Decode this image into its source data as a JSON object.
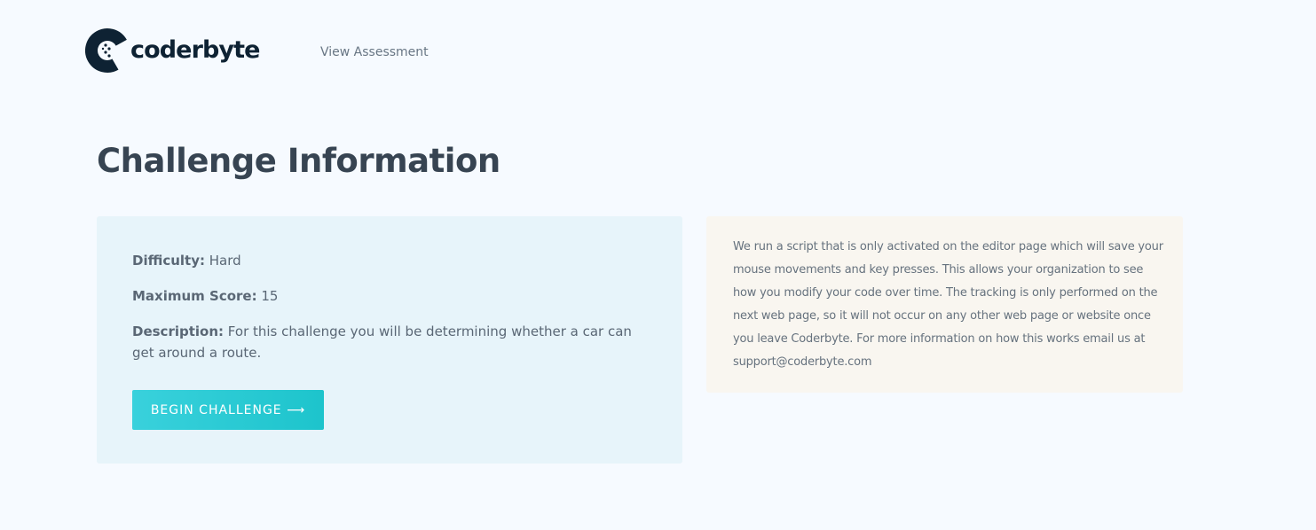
{
  "header": {
    "logo_text": "coderbyte",
    "nav_link": "View Assessment"
  },
  "page": {
    "title": "Challenge Information"
  },
  "challenge": {
    "difficulty_label": "Difficulty:",
    "difficulty_value": "Hard",
    "max_score_label": "Maximum Score:",
    "max_score_value": "15",
    "description_label": "Description:",
    "description_value": "For this challenge you will be determining whether a car can get around a route.",
    "begin_button": "BEGIN CHALLENGE ⟶"
  },
  "notice": {
    "text": "We run a script that is only activated on the editor page which will save your mouse movements and key presses. This allows your organization to see how you modify your code over time. The tracking is only performed on the next web page, so it will not occur on any other web page or website once you leave Coderbyte. For more information on how this works email us at support@coderbyte.com"
  },
  "colors": {
    "background": "#f6faff",
    "brand_dark": "#0e2233",
    "accent": "#1dc4cc",
    "info_card_bg": "#e7f4fa",
    "notice_card_bg": "#f9f6f0"
  },
  "icons": {
    "logo": "coderbyte-logo-icon"
  }
}
